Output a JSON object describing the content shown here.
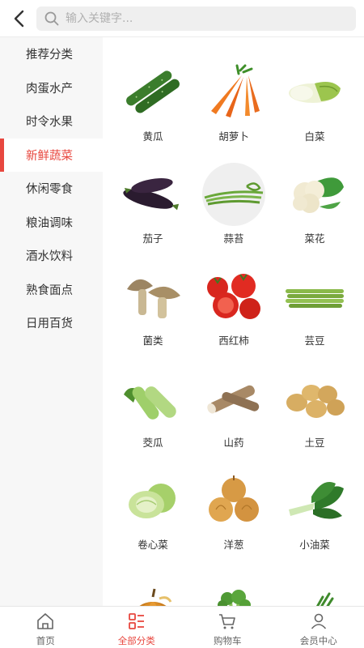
{
  "header": {
    "search_placeholder": "输入关键字..."
  },
  "sidebar": {
    "items": [
      {
        "label": "推荐分类",
        "active": false
      },
      {
        "label": "肉蛋水产",
        "active": false
      },
      {
        "label": "时令水果",
        "active": false
      },
      {
        "label": "新鲜蔬菜",
        "active": true
      },
      {
        "label": "休闲零食",
        "active": false
      },
      {
        "label": "粮油调味",
        "active": false
      },
      {
        "label": "酒水饮料",
        "active": false
      },
      {
        "label": "熟食面点",
        "active": false
      },
      {
        "label": "日用百货",
        "active": false
      }
    ]
  },
  "products": [
    {
      "label": "黄瓜",
      "icon": "cucumber-icon"
    },
    {
      "label": "胡萝卜",
      "icon": "carrot-icon"
    },
    {
      "label": "白菜",
      "icon": "napa-cabbage-icon"
    },
    {
      "label": "茄子",
      "icon": "eggplant-icon"
    },
    {
      "label": "蒜苔",
      "icon": "garlic-scape-icon"
    },
    {
      "label": "菜花",
      "icon": "cauliflower-icon"
    },
    {
      "label": "菌类",
      "icon": "mushroom-icon"
    },
    {
      "label": "西红柿",
      "icon": "tomato-icon"
    },
    {
      "label": "芸豆",
      "icon": "green-bean-icon"
    },
    {
      "label": "茭瓜",
      "icon": "zucchini-icon"
    },
    {
      "label": "山药",
      "icon": "yam-icon"
    },
    {
      "label": "土豆",
      "icon": "potato-icon"
    },
    {
      "label": "卷心菜",
      "icon": "cabbage-icon"
    },
    {
      "label": "洋葱",
      "icon": "onion-icon"
    },
    {
      "label": "小油菜",
      "icon": "bok-choy-icon"
    },
    {
      "label": "",
      "icon": "pumpkin-icon"
    },
    {
      "label": "",
      "icon": "celery-icon"
    },
    {
      "label": "",
      "icon": "scallion-icon"
    }
  ],
  "tabbar": {
    "items": [
      {
        "label": "首页",
        "icon": "home-icon",
        "active": false
      },
      {
        "label": "全部分类",
        "icon": "category-icon",
        "active": true
      },
      {
        "label": "购物车",
        "icon": "cart-icon",
        "active": false
      },
      {
        "label": "会员中心",
        "icon": "user-icon",
        "active": false
      }
    ]
  },
  "colors": {
    "accent": "#e8473f",
    "sidebar_bg": "#f7f7f7",
    "search_bg": "#efefef"
  }
}
